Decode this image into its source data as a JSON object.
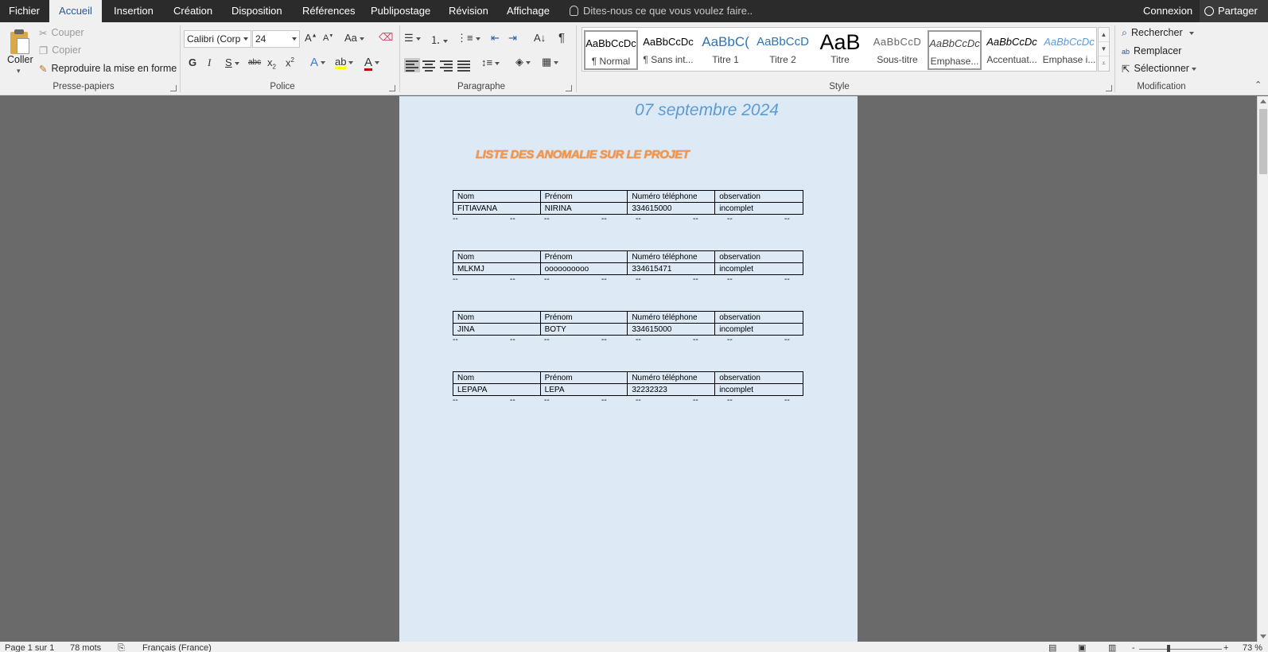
{
  "tabs": {
    "fichier": "Fichier",
    "accueil": "Accueil",
    "insertion": "Insertion",
    "creation": "Création",
    "disposition": "Disposition",
    "references": "Références",
    "publipostage": "Publipostage",
    "revision": "Révision",
    "affichage": "Affichage",
    "tellme": "Dites-nous ce que vous voulez faire..",
    "connexion": "Connexion",
    "partager": "Partager"
  },
  "clipboard": {
    "paste": "Coller",
    "cut": "Couper",
    "copy": "Copier",
    "format_painter": "Reproduire la mise en forme",
    "label": "Presse-papiers"
  },
  "font": {
    "family": "Calibri (Corp",
    "size": "24",
    "grow": "A",
    "shrink": "A",
    "case": "Aa",
    "bold": "G",
    "italic": "I",
    "underline": "S",
    "strike": "abc",
    "subscript": "x",
    "superscript": "x",
    "effects": "A",
    "color": "A",
    "label": "Police",
    "highlight_color": "#ffff00",
    "font_color": "#c00000"
  },
  "paragraph": {
    "label": "Paragraphe",
    "pilcrow": "¶"
  },
  "styles": {
    "label": "Style",
    "items": [
      {
        "preview": "AaBbCcDc",
        "name": "¶ Normal"
      },
      {
        "preview": "AaBbCcDc",
        "name": "¶ Sans int..."
      },
      {
        "preview": "AaBbC(",
        "name": "Titre 1"
      },
      {
        "preview": "AaBbCcD",
        "name": "Titre 2"
      },
      {
        "preview": "AaB",
        "name": "Titre"
      },
      {
        "preview": "AaBbCcD",
        "name": "Sous-titre"
      },
      {
        "preview": "AaBbCcDc",
        "name": "Emphase..."
      },
      {
        "preview": "AaBbCcDc",
        "name": "Accentuat..."
      },
      {
        "preview": "AaBbCcDc",
        "name": "Emphase i..."
      }
    ]
  },
  "editing": {
    "label": "Modification",
    "find": "Rechercher",
    "replace": "Remplacer",
    "select": "Sélectionner"
  },
  "document": {
    "date": "07 septembre 2024",
    "title": "LISTE DES ANOMALIE SUR LE PROJET",
    "headers": [
      "Nom",
      "Prénom",
      "Numéro téléphone",
      "observation"
    ],
    "tables": [
      [
        "FITIAVANA",
        "NIRINA",
        "334615000",
        "incomplet"
      ],
      [
        "MLKMJ",
        "oooooooooo",
        "334615471",
        "incomplet"
      ],
      [
        "JINA",
        "BOTY",
        "334615000",
        "incomplet"
      ],
      [
        "LEPAPA",
        "LEPA",
        "32232323",
        "incomplet"
      ]
    ],
    "dash": "--"
  },
  "status": {
    "page": "Page 1 sur 1",
    "words": "78 mots",
    "language": "Français (France)",
    "zoom": "73 %",
    "zoom_minus": "-",
    "zoom_plus": "+"
  }
}
